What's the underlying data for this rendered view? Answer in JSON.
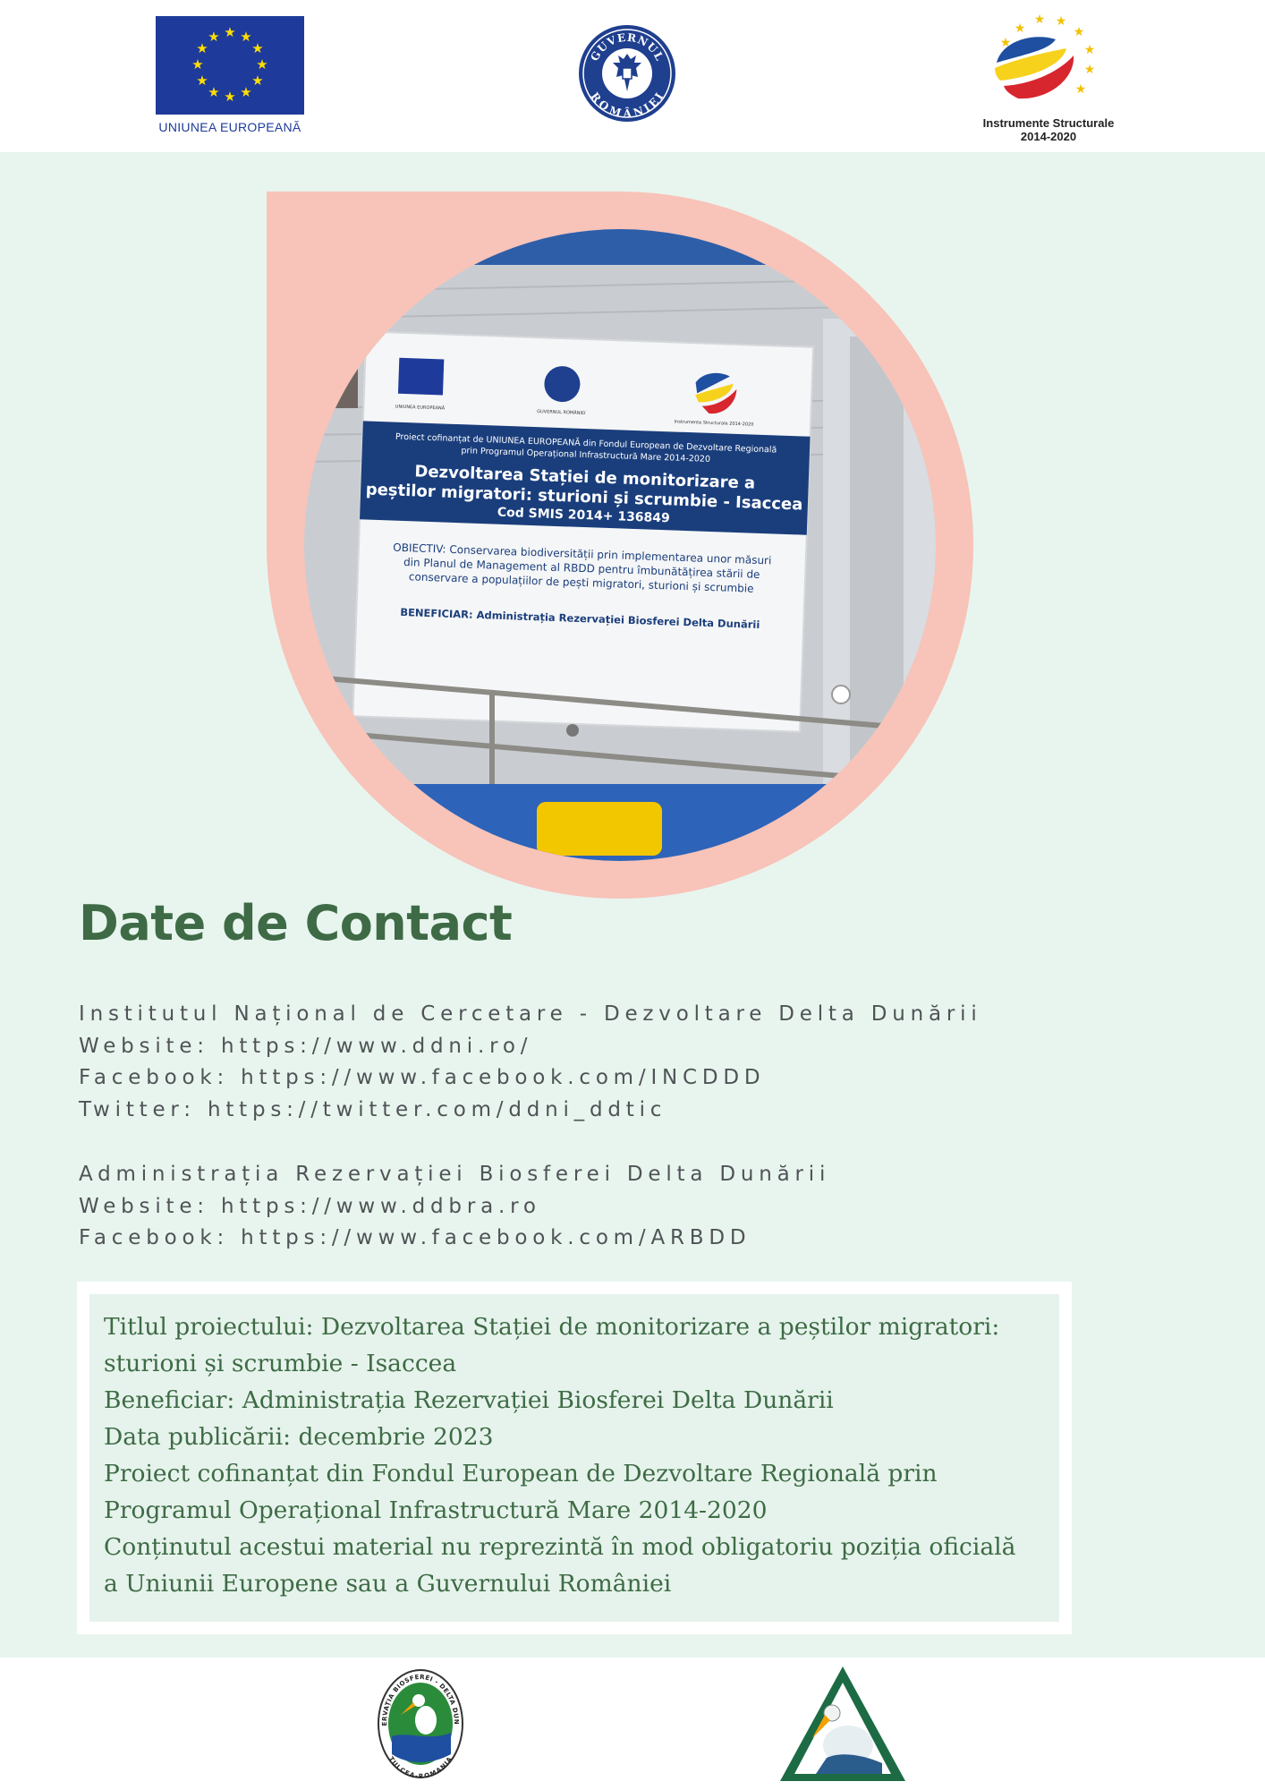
{
  "header": {
    "eu_logo": {
      "caption": "UNIUNEA EUROPEANĂ",
      "icon": "eu-flag-icon",
      "flag_color": "#1e3a9a",
      "star_color": "#ffdd00"
    },
    "gov_logo": {
      "text_top": "GUVERNUL",
      "text_bottom": "ROMÂNIEI",
      "icon": "romanian-coat-of-arms-icon",
      "color": "#1f3f8f"
    },
    "structural_logo": {
      "line1": "Instrumente Structurale",
      "line2": "2014-2020",
      "icon": "instrumente-structurale-icon"
    }
  },
  "photo": {
    "sign": {
      "header_logos": [
        "UNIUNEA EUROPEANĂ",
        "GUVERNUL ROMÂNIEI",
        "Instrumente Structurale 2014-2020"
      ],
      "banner_line1": "Proiect cofinanțat de UNIUNEA EUROPEANĂ din Fondul European de Dezvoltare Regională",
      "banner_line2": "prin Programul Operațional Infrastructură Mare 2014-2020",
      "title_line1": "Dezvoltarea Stației de monitorizare a",
      "title_line2": "peștilor migratori: sturioni și scrumbie - Isaccea",
      "code": "Cod SMIS 2014+ 136849",
      "objective_line1": "OBIECTIV: Conservarea biodiversității prin implementarea unor măsuri",
      "objective_line2": "din Planul de Management al RBDD pentru îmbunătățirea stării de",
      "objective_line3": "conservare a populațiilor de pești migratori, sturioni și scrumbie",
      "beneficiary": "BENEFICIAR: Administrația Rezervației Biosferei Delta Dunării"
    }
  },
  "contact": {
    "title": "Date de Contact",
    "group1": [
      "Institutul Național de Cercetare - Dezvoltare Delta Dunării",
      "Website: https://www.ddni.ro/",
      "Facebook: https://www.facebook.com/INCDDD",
      "Twitter: https://twitter.com/ddni_ddtic"
    ],
    "group2": [
      "Administrația Rezervației Biosferei Delta Dunării",
      "Website: https://www.ddbra.ro",
      "Facebook: https://www.facebook.com/ARBDD"
    ]
  },
  "project_info": {
    "lines": [
      "Titlul proiectului: Dezvoltarea Stației de monitorizare a peștilor migratori:",
      "sturioni și scrumbie - Isaccea",
      "Beneficiar: Administrația Rezervației Biosferei Delta Dunării",
      "Data publicării: decembrie 2023",
      "Proiect cofinanțat din Fondul European de Dezvoltare Regională prin",
      "Programul Operațional Infrastructură Mare 2014-2020",
      "Conținutul acestui material nu reprezintă în mod obligatoriu poziția oficială",
      "a Uniunii Europene sau a Guvernului României"
    ]
  },
  "footer": {
    "ddbra_logo": {
      "text_ring": "REZERVAȚIA BIOSFEREI - DELTA DUNĂRII",
      "text_bottom": "TULCEA-ROMANIA",
      "icon": "ddbra-pelican-icon"
    },
    "ddni_logo": {
      "icon": "ddni-pelican-triangle-icon"
    }
  },
  "colors": {
    "main_bg": "#e8f5ef",
    "title_green": "#3e6b45",
    "contact_gray": "#505356",
    "pink": "#f8c3b8",
    "sign_blue": "#1a3e7c"
  }
}
